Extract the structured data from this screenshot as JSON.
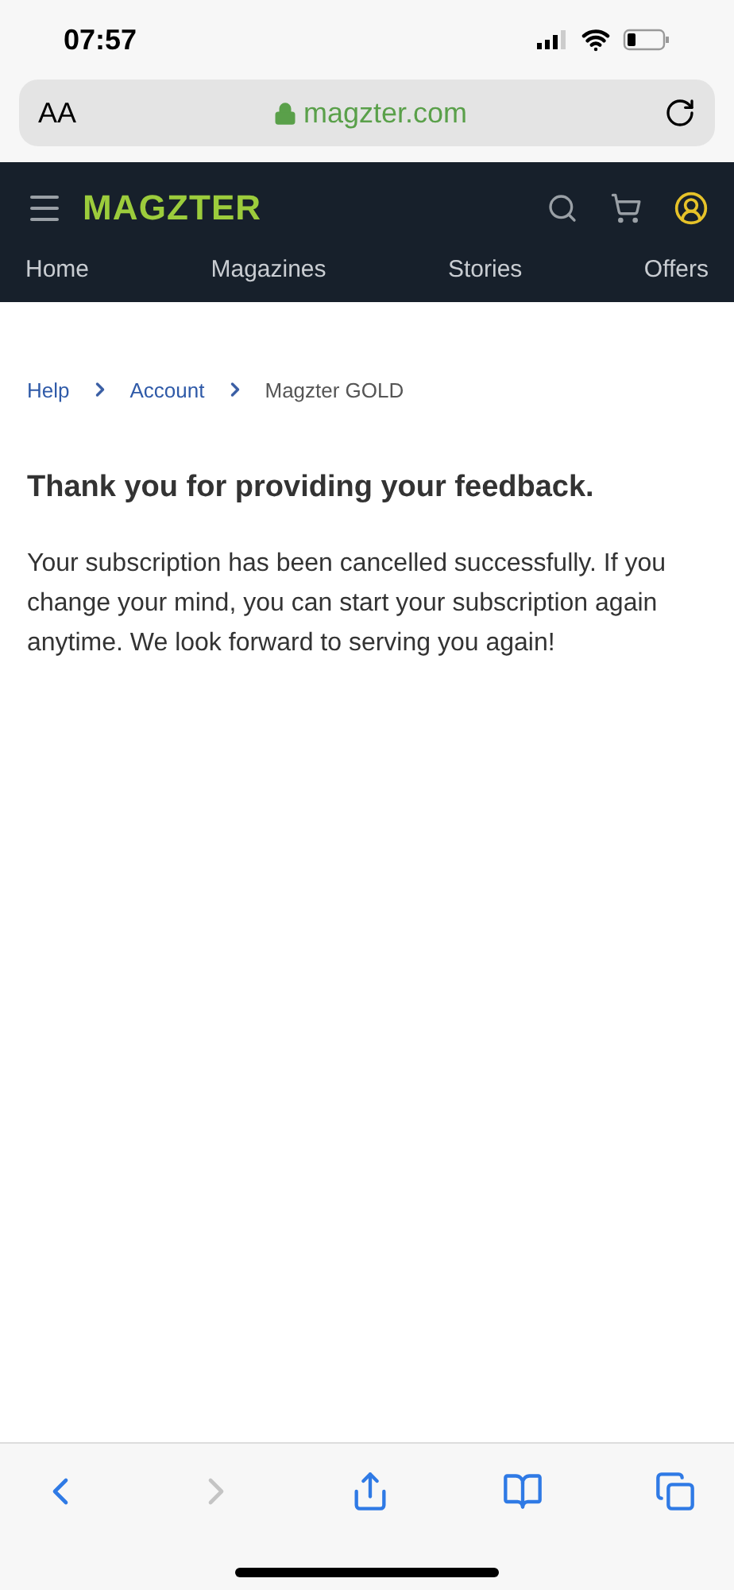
{
  "status_bar": {
    "time": "07:57"
  },
  "address_bar": {
    "text_size": "AA",
    "url": "magzter.com"
  },
  "header": {
    "logo": "MAGZTER"
  },
  "nav": [
    {
      "label": "Home"
    },
    {
      "label": "Magazines"
    },
    {
      "label": "Stories"
    },
    {
      "label": "Offers"
    }
  ],
  "breadcrumb": [
    {
      "label": "Help",
      "link": true
    },
    {
      "label": "Account",
      "link": true
    },
    {
      "label": "Magzter GOLD",
      "link": false
    }
  ],
  "heading": "Thank you for providing your feedback.",
  "message": "Your subscription has been cancelled successfully. If you change your mind, you can start your subscription again anytime. We look forward to serving you again!",
  "toolbar": {
    "back_disabled": false,
    "forward_disabled": true
  }
}
